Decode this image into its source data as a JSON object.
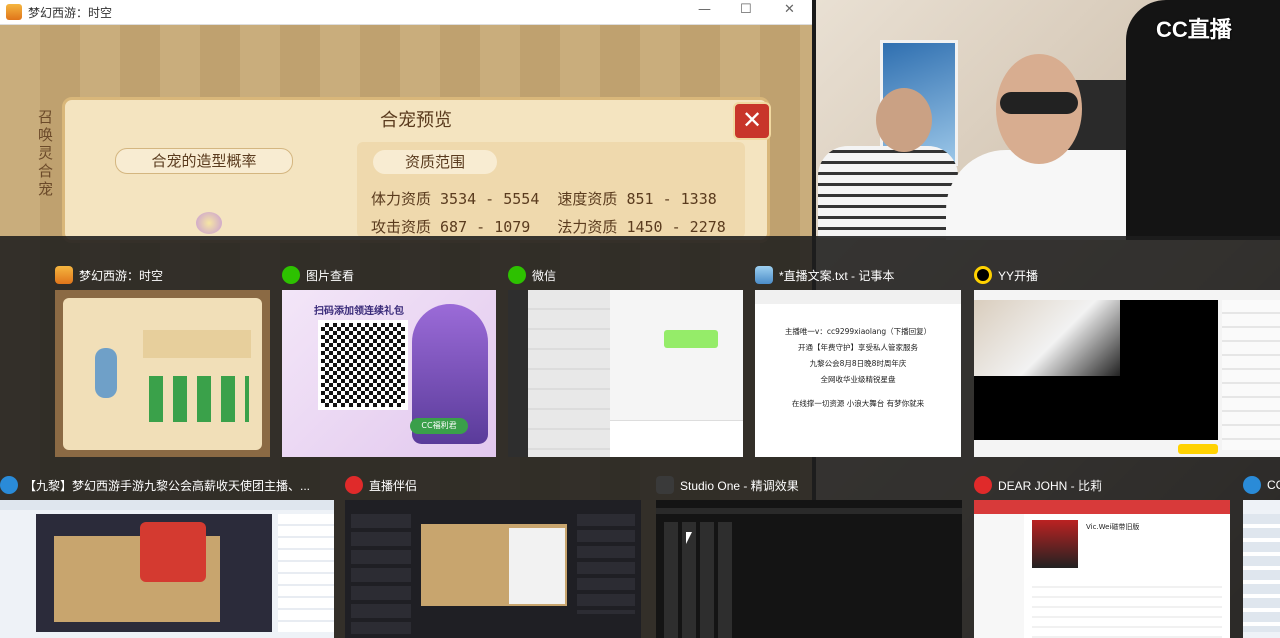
{
  "game_window": {
    "title": "梦幻西游：时空",
    "minimize": "—",
    "maximize": "☐",
    "close": "✕",
    "side_label": "召唤灵合宠",
    "panel_title": "合宠预览",
    "panel_close": "✕",
    "tab_shape": "合宠的造型概率",
    "tab_quality": "资质范围",
    "quality_line1": "体力资质 3534 - 5554  速度资质 851 - 1338",
    "quality_line2": "攻击资质 687 - 1079   法力资质 1450 - 2278"
  },
  "webcam": {
    "logo": "CC直播"
  },
  "switcher": {
    "row1": [
      {
        "title": "梦幻西游：时空",
        "icon": "game-icon"
      },
      {
        "title": "图片查看",
        "icon": "photo-viewer-icon"
      },
      {
        "title": "微信",
        "icon": "wechat-icon"
      },
      {
        "title": "*直播文案.txt - 记事本",
        "icon": "notepad-icon"
      },
      {
        "title": "YY开播",
        "icon": "yy-icon"
      }
    ],
    "row2": [
      {
        "title": "【九黎】梦幻西游手游九黎公会高薪收天使团主播、...",
        "icon": "cc-icon"
      },
      {
        "title": "直播伴侣",
        "icon": "live-companion-icon"
      },
      {
        "title": "Studio One - 精调效果",
        "icon": "studio-one-icon"
      },
      {
        "title": "DEAR JOHN - 比莉",
        "icon": "netease-music-icon"
      },
      {
        "title": "CC",
        "icon": "cc-icon"
      }
    ]
  },
  "thumb_photo": {
    "banner": "扫码添加领连续礼包",
    "badge": "CC福利君"
  },
  "thumb_notepad": {
    "line1": "主播唯一v：cc9299xiaolang（下播回复）",
    "line2": "开通【年费守护】享受私人管家服务",
    "line3": "九黎公会8月8日晚8时周年庆",
    "line4": "全网收华业级精锐星盘",
    "line5": "在线撑一切资源  小浪大舞台 有梦你就来"
  },
  "thumb_music": {
    "song": "Vic.Wei磁带旧版"
  },
  "colors": {
    "switcher_bg": "#1e1e1e",
    "game_panel": "#f4e4c0",
    "close_red": "#c8352a"
  }
}
